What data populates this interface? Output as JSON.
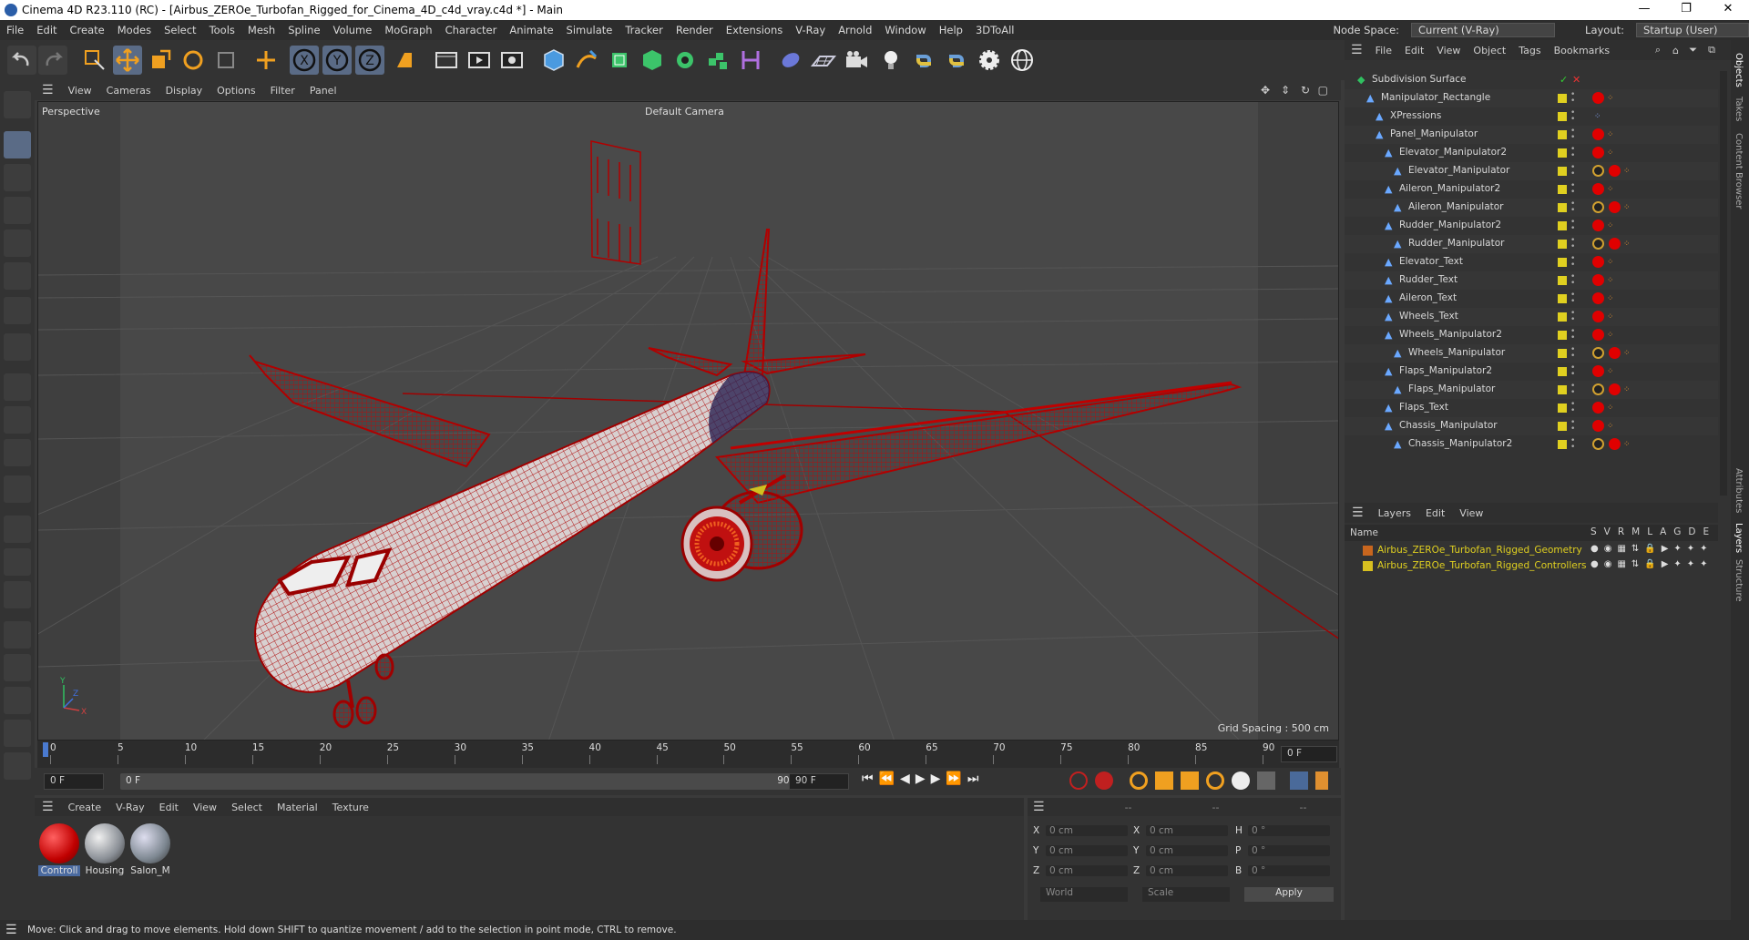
{
  "window": {
    "title": "Cinema 4D R23.110 (RC) - [Airbus_ZEROe_Turbofan_Rigged_for_Cinema_4D_c4d_vray.c4d *] - Main",
    "minimize": "—",
    "maximize": "❐",
    "close": "✕"
  },
  "menu": [
    "File",
    "Edit",
    "Create",
    "Modes",
    "Select",
    "Tools",
    "Mesh",
    "Spline",
    "Volume",
    "MoGraph",
    "Character",
    "Animate",
    "Simulate",
    "Tracker",
    "Render",
    "Extensions",
    "V-Ray",
    "Arnold",
    "Window",
    "Help",
    "3DToAll"
  ],
  "node_space": {
    "label": "Node Space:",
    "value": "Current (V-Ray)"
  },
  "layout": {
    "label": "Layout:",
    "value": "Startup (User)"
  },
  "viewport": {
    "menu": [
      "View",
      "Cameras",
      "Display",
      "Options",
      "Filter",
      "Panel"
    ],
    "name": "Perspective",
    "camera": "Default Camera",
    "grid_spacing": "Grid Spacing : 500 cm"
  },
  "timeline": {
    "ticks": [
      "0",
      "5",
      "10",
      "15",
      "20",
      "25",
      "30",
      "35",
      "40",
      "45",
      "50",
      "55",
      "60",
      "65",
      "70",
      "75",
      "80",
      "85",
      "90"
    ],
    "current_frame": "0 F"
  },
  "transport": {
    "start": "0 F",
    "range_start": "0 F",
    "range_end": "90 F",
    "end": "90 F"
  },
  "materials": {
    "menu": [
      "Create",
      "V-Ray",
      "Edit",
      "View",
      "Select",
      "Material",
      "Texture"
    ],
    "items": [
      {
        "name": "Controll",
        "color": "#d40000"
      },
      {
        "name": "Housing",
        "color": "#8a8f96"
      },
      {
        "name": "Salon_M",
        "color": "#7d8791"
      }
    ]
  },
  "attributes": {
    "header": [
      "--",
      "--",
      "--"
    ],
    "rows": [
      {
        "a": "X",
        "av": "0 cm",
        "b": "X",
        "bv": "0 cm",
        "c": "H",
        "cv": "0 °"
      },
      {
        "a": "Y",
        "av": "0 cm",
        "b": "Y",
        "bv": "0 cm",
        "c": "P",
        "cv": "0 °"
      },
      {
        "a": "Z",
        "av": "0 cm",
        "b": "Z",
        "bv": "0 cm",
        "c": "B",
        "cv": "0 °"
      }
    ],
    "coord_system": "World",
    "mode": "Scale",
    "apply": "Apply"
  },
  "status": "Move: Click and drag to move elements. Hold down SHIFT to quantize movement / add to the selection in point mode, CTRL to remove.",
  "objects": {
    "menu": [
      "File",
      "Edit",
      "View",
      "Object",
      "Tags",
      "Bookmarks"
    ],
    "items": [
      {
        "name": "Subdivision Surface",
        "indent": 0,
        "tag": "none"
      },
      {
        "name": "Manipulator_Rectangle",
        "indent": 1,
        "tag": "red"
      },
      {
        "name": "XPressions",
        "indent": 2,
        "tag": "xp"
      },
      {
        "name": "Panel_Manipulator",
        "indent": 2,
        "tag": "red"
      },
      {
        "name": "Elevator_Manipulator2",
        "indent": 3,
        "tag": "red"
      },
      {
        "name": "Elevator_Manipulator",
        "indent": 4,
        "tag": "lock"
      },
      {
        "name": "Aileron_Manipulator2",
        "indent": 3,
        "tag": "red"
      },
      {
        "name": "Aileron_Manipulator",
        "indent": 4,
        "tag": "lock"
      },
      {
        "name": "Rudder_Manipulator2",
        "indent": 3,
        "tag": "red"
      },
      {
        "name": "Rudder_Manipulator",
        "indent": 4,
        "tag": "lock"
      },
      {
        "name": "Elevator_Text",
        "indent": 3,
        "tag": "red"
      },
      {
        "name": "Rudder_Text",
        "indent": 3,
        "tag": "red"
      },
      {
        "name": "Aileron_Text",
        "indent": 3,
        "tag": "red"
      },
      {
        "name": "Wheels_Text",
        "indent": 3,
        "tag": "red"
      },
      {
        "name": "Wheels_Manipulator2",
        "indent": 3,
        "tag": "red"
      },
      {
        "name": "Wheels_Manipulator",
        "indent": 4,
        "tag": "lock"
      },
      {
        "name": "Flaps_Manipulator2",
        "indent": 3,
        "tag": "red"
      },
      {
        "name": "Flaps_Manipulator",
        "indent": 4,
        "tag": "lock"
      },
      {
        "name": "Flaps_Text",
        "indent": 3,
        "tag": "red"
      },
      {
        "name": "Chassis_Manipulator",
        "indent": 3,
        "tag": "red"
      },
      {
        "name": "Chassis_Manipulator2",
        "indent": 4,
        "tag": "lock"
      }
    ]
  },
  "layers": {
    "menu": [
      "Layers",
      "Edit",
      "View"
    ],
    "col_name": "Name",
    "cols": [
      "S",
      "V",
      "R",
      "M",
      "L",
      "A",
      "G",
      "D",
      "E"
    ],
    "items": [
      {
        "name": "Airbus_ZEROe_Turbofan_Rigged_Geometry",
        "color": "#c8661e"
      },
      {
        "name": "Airbus_ZEROe_Turbofan_Rigged_Controllers",
        "color": "#d8c020"
      }
    ]
  },
  "side_tabs": [
    "Objects",
    "Takes",
    "Content Browser",
    "Attributes",
    "Layers",
    "Structure"
  ]
}
